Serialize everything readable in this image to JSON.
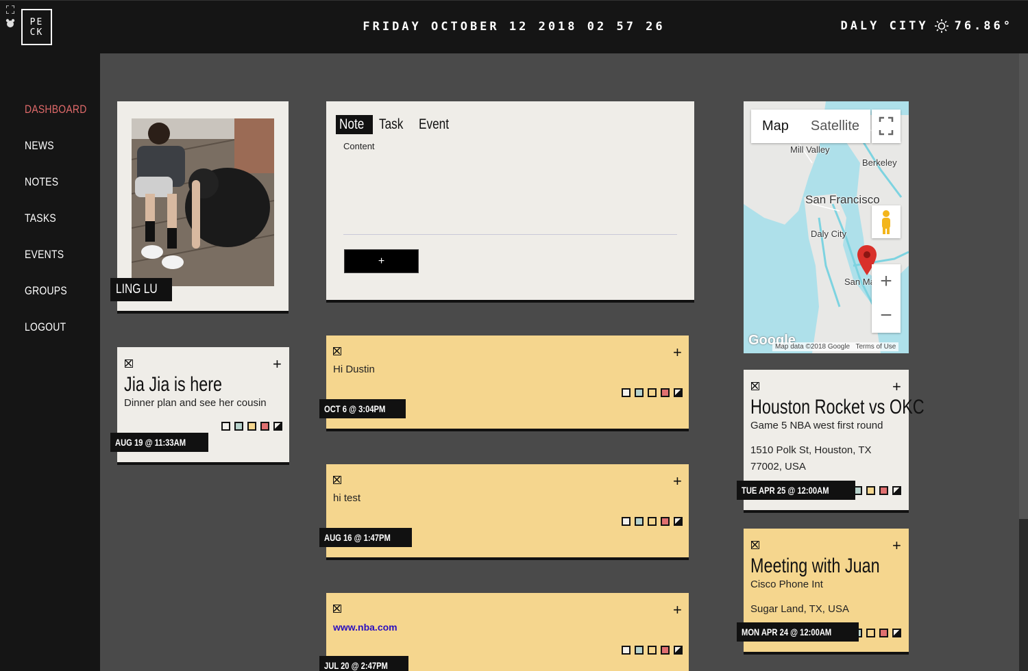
{
  "topbar": {
    "logo_line1": "PE",
    "logo_line2": "CK",
    "datetime": "FRIDAY OCTOBER 12 2018 02 57 26",
    "city": "DALY CITY",
    "temperature": "76.86°",
    "weather_icon": "sun-icon"
  },
  "sidebar": {
    "items": [
      {
        "label": "DASHBOARD",
        "active": true
      },
      {
        "label": "NEWS"
      },
      {
        "label": "NOTES"
      },
      {
        "label": "TASKS"
      },
      {
        "label": "EVENTS"
      },
      {
        "label": "GROUPS"
      },
      {
        "label": "LOGOUT"
      }
    ]
  },
  "profile": {
    "name": "LING LU"
  },
  "composer": {
    "tabs": [
      "Note",
      "Task",
      "Event"
    ],
    "active_tab": "Note",
    "content_label": "Content",
    "content_value": "",
    "add_label": "+"
  },
  "notes_left": [
    {
      "title": "Jia Jia is here",
      "body": "Dinner plan and see her cousin",
      "stamp": "AUG 19 @ 11:33AM",
      "color": "#efede8"
    }
  ],
  "notes_center": [
    {
      "body": "Hi Dustin",
      "stamp": "OCT 6 @ 3:04PM",
      "color": "#f5d68e"
    },
    {
      "body": "hi test",
      "stamp": "AUG 16 @ 1:47PM",
      "color": "#f5d68e"
    },
    {
      "body": "www.nba.com",
      "stamp": "JUL 20 @ 2:47PM",
      "color": "#f5d68e",
      "is_link": true
    }
  ],
  "events": [
    {
      "title": "Houston Rocket vs OKC",
      "subtitle": "Game 5 NBA west first round",
      "location": "1510 Polk St, Houston, TX 77002, USA",
      "stamp": "TUE APR 25 @ 12:00AM",
      "color": "#efede8"
    },
    {
      "title": "Meeting with Juan",
      "subtitle": "Cisco Phone Int",
      "location": "Sugar Land, TX, USA",
      "stamp": "MON APR 24 @ 12:00AM",
      "color": "#f5d68e"
    }
  ],
  "map": {
    "type_map": "Map",
    "type_satellite": "Satellite",
    "labels": {
      "mill_valley": "Mill Valley",
      "berkeley": "Berkeley",
      "san_francisco": "San Francisco",
      "daly_city": "Daly City",
      "san_mateo": "San Ma"
    },
    "logo": "Google",
    "attribution": "Map data ©2018 Google",
    "terms": "Terms of Use",
    "zoom_in": "+",
    "zoom_out": "−"
  },
  "swatch_colors": [
    "#f3f1ec",
    "#b8d3cc",
    "#f5d68e",
    "#e07070",
    "#111111"
  ]
}
